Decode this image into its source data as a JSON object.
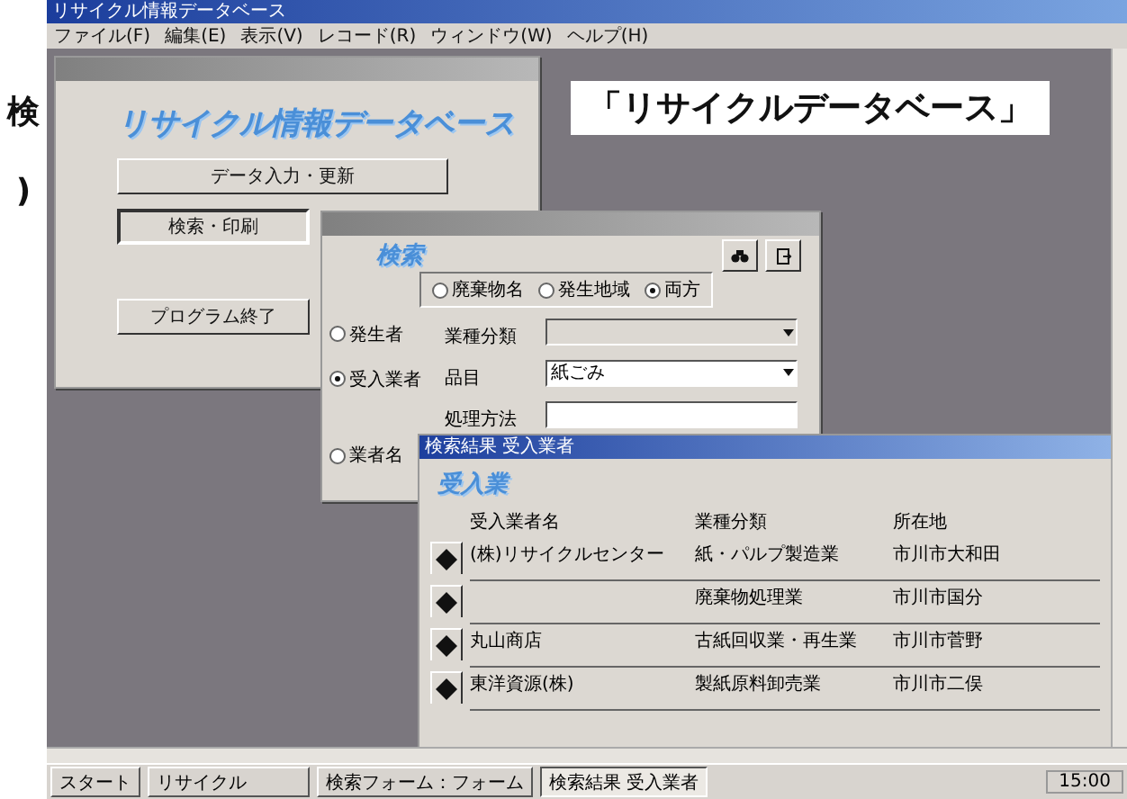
{
  "margin_text": [
    "検",
    ")"
  ],
  "window": {
    "title": "リサイクル情報データベース"
  },
  "menu": [
    "ファイル(F)",
    "編集(E)",
    "表示(V)",
    "レコード(R)",
    "ウィンドウ(W)",
    "ヘルプ(H)"
  ],
  "caption": "「リサイクルデータベース」",
  "main_form": {
    "heading": "リサイクル情報データベース",
    "buttons": [
      {
        "label": "データ入力・更新",
        "selected": false
      },
      {
        "label": "検索・印刷",
        "selected": true
      },
      {
        "label": "プログラム終了",
        "selected": false
      }
    ]
  },
  "search_form": {
    "heading": "検索",
    "mode_options": [
      {
        "label": "廃棄物名",
        "selected": false
      },
      {
        "label": "発生地域",
        "selected": false
      },
      {
        "label": "両方",
        "selected": true
      }
    ],
    "rows": [
      {
        "option": {
          "label": "発生者",
          "selected": false
        },
        "field_label": "業種分類",
        "kind": "combo"
      },
      {
        "option": {
          "label": "受入業者",
          "selected": true
        },
        "field_label": "品目",
        "kind": "combo",
        "value": "紙ごみ"
      },
      {
        "field_label": "処理方法",
        "kind": "text"
      },
      {
        "option": {
          "label": "業者名",
          "selected": false
        }
      }
    ]
  },
  "results": {
    "title": "検索結果 受入業者",
    "heading": "受入業",
    "columns": [
      "受入業者名",
      "業種分類",
      "所在地"
    ],
    "rows": [
      {
        "cells": [
          "(株)リサイクルセンター",
          "紙・パルプ製造業",
          "市川市大和田"
        ]
      },
      {
        "cells": [
          "",
          "廃棄物処理業",
          "市川市国分"
        ]
      },
      {
        "cells": [
          "丸山商店",
          "古紙回収業・再生業",
          "市川市菅野"
        ]
      },
      {
        "cells": [
          "東洋資源(株)",
          "製紙原料卸売業",
          "市川市二俣"
        ]
      }
    ]
  },
  "taskbar": {
    "start": "スタート",
    "tasks": [
      {
        "label": "リサイクル",
        "selected": false
      },
      {
        "label": "検索フォーム：フォーム",
        "selected": false
      },
      {
        "label": "検索結果 受入業者",
        "selected": true
      }
    ],
    "clock": "15:00"
  }
}
